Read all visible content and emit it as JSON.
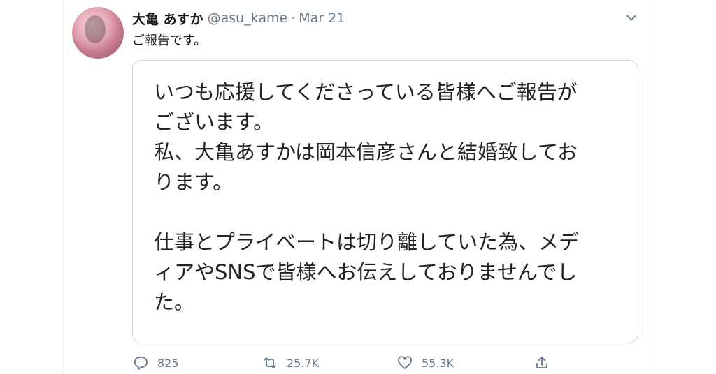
{
  "tweet": {
    "display_name": "大亀 あすか",
    "handle": "@asu_kame",
    "separator": "·",
    "date": "Mar 21",
    "text": "ご報告です。",
    "image_lines": [
      "いつも応援してくださっている皆様へご報告が",
      "ございます。",
      "私、大亀あすかは岡本信彦さんと結婚致してお",
      "ります。",
      "",
      "仕事とプライベートは切り離していた為、メデ",
      "ィアやSNSで皆様へお伝えしておりませんでし",
      "た。"
    ],
    "actions": {
      "reply_count": "825",
      "retweet_count": "25.7K",
      "like_count": "55.3K"
    }
  },
  "icons": {
    "caret": "chevron-down-icon",
    "reply": "reply-icon",
    "retweet": "retweet-icon",
    "like": "heart-icon",
    "share": "share-icon"
  },
  "colors": {
    "text": "#14171a",
    "secondary": "#657786",
    "border": "#ccd6dd"
  }
}
